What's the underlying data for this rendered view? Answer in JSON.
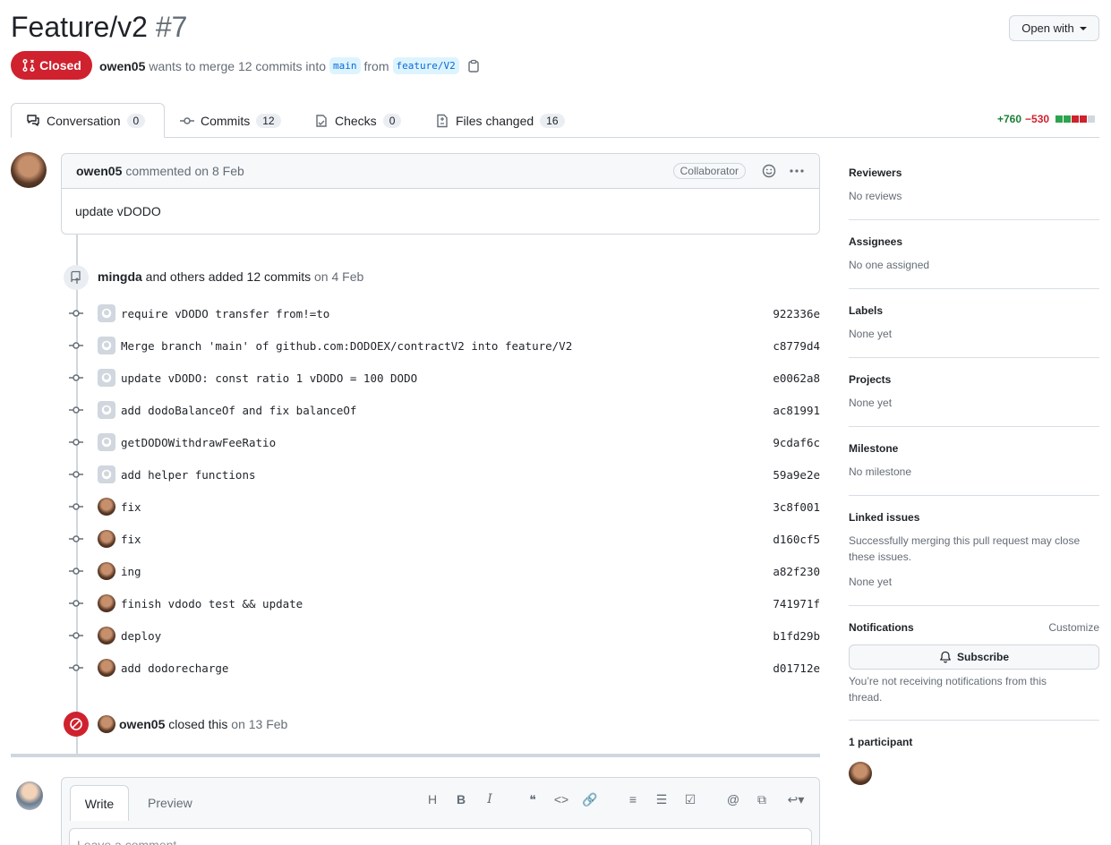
{
  "header": {
    "title": "Feature/v2",
    "number": "#7",
    "open_with": "Open with"
  },
  "state": {
    "label": "Closed"
  },
  "meta": {
    "author": "owen05",
    "text": "wants to merge 12 commits into",
    "base": "main",
    "from": "from",
    "head": "feature/V2"
  },
  "tabs": [
    {
      "label": "Conversation",
      "count": "0"
    },
    {
      "label": "Commits",
      "count": "12"
    },
    {
      "label": "Checks",
      "count": "0"
    },
    {
      "label": "Files changed",
      "count": "16"
    }
  ],
  "diffstat": {
    "add": "+760",
    "del": "−530"
  },
  "comment": {
    "author": "owen05",
    "action": "commented",
    "date": "on 8 Feb",
    "badge": "Collaborator",
    "body": "update vDODO"
  },
  "commit_event": {
    "actor": "mingda",
    "text": "and others added 12 commits",
    "date": "on 4 Feb"
  },
  "commits": [
    {
      "msg": "require vDODO transfer from!=to",
      "sha": "922336e",
      "avatar": "github"
    },
    {
      "msg": "Merge branch 'main' of github.com:DODOEX/contractV2 into feature/V2",
      "sha": "c8779d4",
      "avatar": "github"
    },
    {
      "msg": "update vDODO: const ratio 1 vDODO = 100 DODO",
      "sha": "e0062a8",
      "avatar": "github"
    },
    {
      "msg": "add dodoBalanceOf and fix balanceOf",
      "sha": "ac81991",
      "avatar": "github"
    },
    {
      "msg": "getDODOWithdrawFeeRatio",
      "sha": "9cdaf6c",
      "avatar": "github"
    },
    {
      "msg": "add helper functions",
      "sha": "59a9e2e",
      "avatar": "github"
    },
    {
      "msg": "fix",
      "sha": "3c8f001",
      "avatar": "user"
    },
    {
      "msg": "fix",
      "sha": "d160cf5",
      "avatar": "user"
    },
    {
      "msg": "ing",
      "sha": "a82f230",
      "avatar": "user"
    },
    {
      "msg": "finish vdodo test && update",
      "sha": "741971f",
      "avatar": "user"
    },
    {
      "msg": "deploy",
      "sha": "b1fd29b",
      "avatar": "user"
    },
    {
      "msg": "add dodorecharge",
      "sha": "d01712e",
      "avatar": "user"
    }
  ],
  "closed_event": {
    "actor": "owen05",
    "text": "closed this",
    "date": "on 13 Feb"
  },
  "sidebar": {
    "reviewers": {
      "h": "Reviewers",
      "v": "No reviews"
    },
    "assignees": {
      "h": "Assignees",
      "v": "No one assigned"
    },
    "labels": {
      "h": "Labels",
      "v": "None yet"
    },
    "projects": {
      "h": "Projects",
      "v": "None yet"
    },
    "milestone": {
      "h": "Milestone",
      "v": "No milestone"
    },
    "linked": {
      "h": "Linked issues",
      "v": "Successfully merging this pull request may close these issues.",
      "v2": "None yet"
    },
    "notifications": {
      "h": "Notifications",
      "customize": "Customize",
      "subscribe": "Subscribe",
      "v": "You’re not receiving notifications from this thread."
    },
    "participants": {
      "h": "1 participant"
    }
  },
  "editor": {
    "write": "Write",
    "preview": "Preview",
    "placeholder": "Leave a comment"
  }
}
